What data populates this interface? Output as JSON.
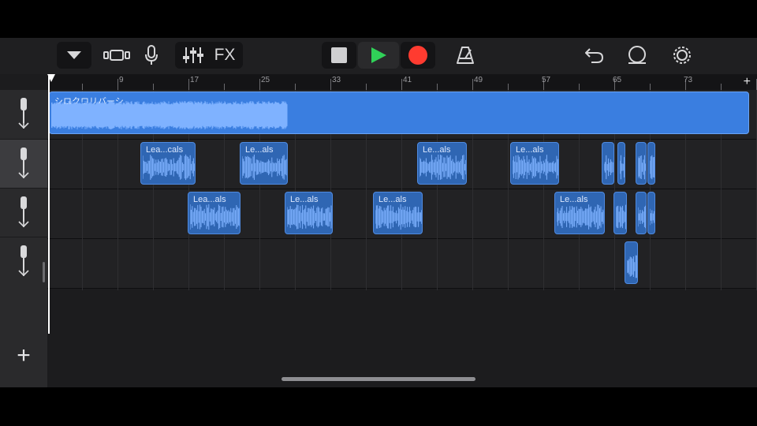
{
  "toolbar": {
    "fx_label": "FX",
    "play_color": "#30d158",
    "record_color": "#ff3b30",
    "icons": [
      "dropdown-icon",
      "track-view-icon",
      "microphone-icon",
      "mixer-icon",
      "stop-icon",
      "play-icon",
      "record-icon",
      "metronome-icon",
      "undo-icon",
      "loop-icon",
      "settings-icon"
    ]
  },
  "ruler": {
    "numbers": [
      "9",
      "17",
      "25",
      "33",
      "41",
      "49",
      "57",
      "65",
      "73"
    ],
    "add_label": "+"
  },
  "tracks": [
    {
      "icon": "microphone-icon",
      "selected": false
    },
    {
      "icon": "microphone-icon",
      "selected": true
    },
    {
      "icon": "microphone-icon",
      "selected": false
    },
    {
      "icon": "microphone-icon",
      "selected": false
    }
  ],
  "add_track_label": "+",
  "regions": {
    "master": {
      "label": "シロクロリバーシ"
    },
    "track2": [
      {
        "label": "Lea...cals"
      },
      {
        "label": "Le...als"
      },
      {
        "label": "Le...als"
      },
      {
        "label": "Le...als"
      },
      {
        "label": ""
      },
      {
        "label": ""
      },
      {
        "label": ""
      },
      {
        "label": ""
      }
    ],
    "track3": [
      {
        "label": "Lea...als"
      },
      {
        "label": "Le...als"
      },
      {
        "label": "Le...als"
      },
      {
        "label": "Le...als"
      },
      {
        "label": ""
      },
      {
        "label": ""
      },
      {
        "label": ""
      }
    ],
    "track4": [
      {
        "label": ""
      }
    ]
  },
  "colors": {
    "region": "#2f66b3",
    "region_master": "#3a7ee0",
    "waveform": "#7fb2ff"
  }
}
